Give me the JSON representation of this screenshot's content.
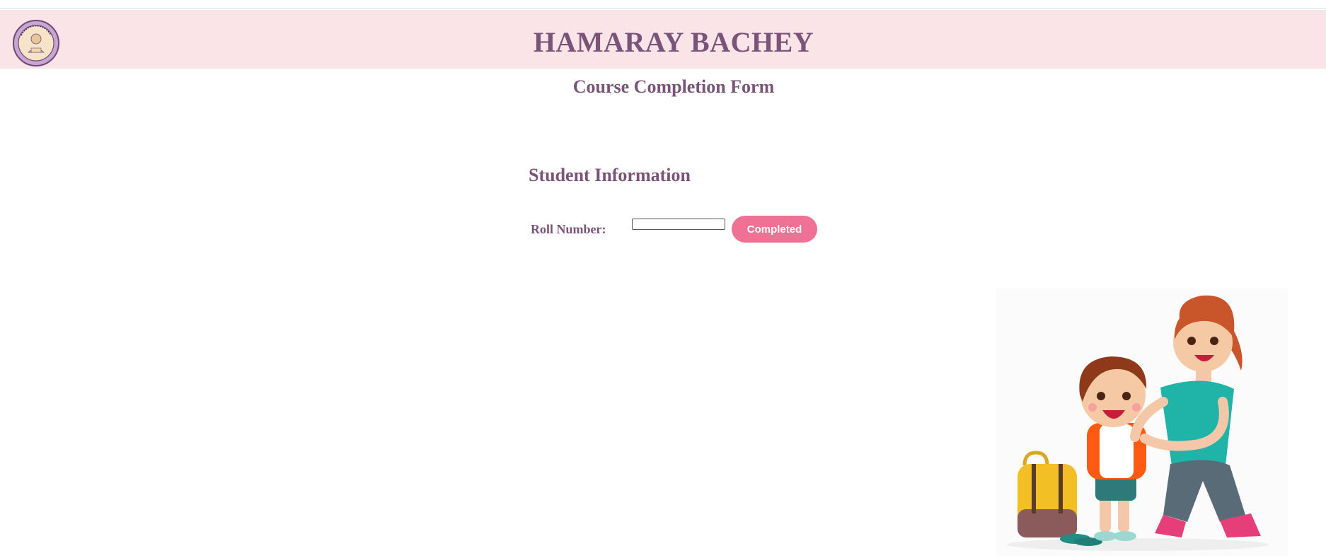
{
  "header": {
    "site_title": "HAMARAY BACHEY",
    "logo": {
      "icon": "school-emblem-logo",
      "text": "Hamaray Bachey"
    }
  },
  "page": {
    "form_title": "Course Completion Form"
  },
  "section": {
    "title": "Student Information"
  },
  "form": {
    "roll_label": "Roll Number:",
    "roll_value": "",
    "roll_placeholder": "",
    "submit_label": "Completed"
  },
  "colors": {
    "header_bg": "#fbe4e8",
    "heading_text": "#7a5478",
    "button_bg": "#ef7193",
    "button_text": "#ffffff"
  },
  "illustration": {
    "icon": "mother-and-child-with-school-bag-illustration"
  }
}
